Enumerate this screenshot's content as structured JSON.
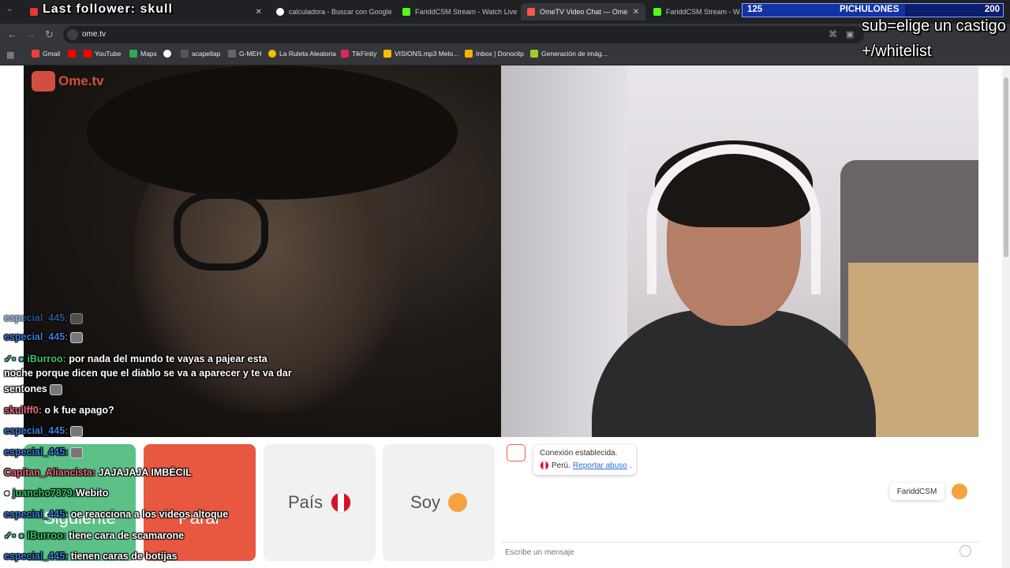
{
  "overlays": {
    "last_follower": "Last follower: skull",
    "goal_count": "125",
    "goal_name": "PICHULONES",
    "goal_target": "200",
    "sub_text_1": "sub=elige un castigo",
    "sub_text_2": "+/whitelist"
  },
  "tabs": [
    {
      "label": "calculadora - Buscar con Google",
      "favicon": "google"
    },
    {
      "label": "FariddCSM Stream - Watch Live",
      "favicon": "kick"
    },
    {
      "label": "OmeTV Video Chat — Ome",
      "favicon": "ometv"
    },
    {
      "label": "FariddCSM Stream - Watch",
      "favicon": "kick"
    }
  ],
  "toolbar": {
    "url": "ome.tv"
  },
  "bookmarks": [
    {
      "label": "Gmail",
      "icon": "gmail-icon"
    },
    {
      "label": "YouTube",
      "icon": "youtube-icon"
    },
    {
      "label": "Maps",
      "icon": "maps-icon"
    },
    {
      "label": "acapellap",
      "icon": "link-icon"
    },
    {
      "label": "G-MEH",
      "icon": "link-icon"
    },
    {
      "label": "La Ruleta Aleatoria",
      "icon": "link-icon"
    },
    {
      "label": "TikFinity",
      "icon": "link-icon"
    },
    {
      "label": "VISIONS.mp3 Melo...",
      "icon": "drive-icon"
    },
    {
      "label": "Inbox | Donoclip",
      "icon": "link-icon"
    },
    {
      "label": "Generación de imág...",
      "icon": "link-icon"
    }
  ],
  "ometv": {
    "logo_text": "Ome.tv",
    "buttons": {
      "next": "Siguiente",
      "stop": "Parar",
      "country": "País",
      "me": "Soy"
    },
    "connection_status": "Conexión establecida.",
    "country_name": "Perú.",
    "report_link": "Reportar abuso",
    "report_suffix": ".",
    "own_username": "FariddCSM",
    "input_placeholder": "Escribe un mensaje",
    "colors": {
      "next": "#5cc187",
      "stop": "#e8573f",
      "neutral": "#f1f1f1"
    }
  },
  "chat_messages": [
    {
      "user": "especial_445:",
      "text": ""
    },
    {
      "user": "especial_445:",
      "text": ""
    },
    {
      "user": "iBurroo:",
      "text": "por nada del mundo te vayas a pajear esta"
    },
    {
      "user": "",
      "text": "noche porque dicen que el diablo se va a aparecer y te va dar"
    },
    {
      "user": "",
      "text": "sentones"
    },
    {
      "user": "skullff0:",
      "text": "o k fue apago?"
    },
    {
      "user": "especial_445:",
      "text": ""
    },
    {
      "user": "especial_445:",
      "text": ""
    },
    {
      "user": "Capitan_Aliancista:",
      "text": "JAJAJAJA IMBÉCIL"
    },
    {
      "user": "juancho7879:",
      "text": "Webito"
    },
    {
      "user": "especial_445:",
      "text": "oe reacciona a los videos altoque"
    },
    {
      "user": "iBurroo:",
      "text": "tiene cara de scamarone"
    },
    {
      "user": "especial_445:",
      "text": "tienen caras de botijas"
    }
  ]
}
